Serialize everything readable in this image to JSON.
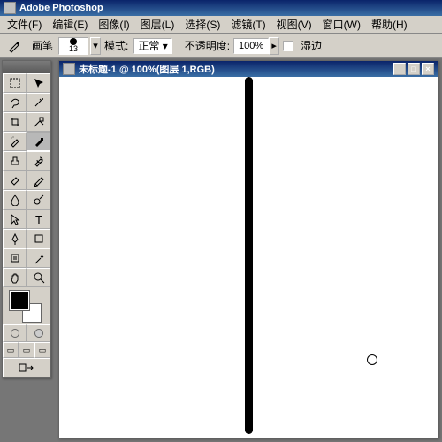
{
  "app": {
    "title": "Adobe Photoshop"
  },
  "menu": [
    "文件(F)",
    "编辑(E)",
    "图像(I)",
    "图层(L)",
    "选择(S)",
    "滤镜(T)",
    "视图(V)",
    "窗口(W)",
    "帮助(H)"
  ],
  "options": {
    "brush_label": "画笔",
    "brush_size": "13",
    "mode_label": "模式:",
    "mode_value": "正常",
    "opacity_label": "不透明度:",
    "opacity_value": "100%",
    "wet_label": "湿边"
  },
  "doc": {
    "title": "未标题-1 @ 100%(图层 1,RGB)"
  },
  "colors": {
    "fg": "#000000",
    "bg": "#ffffff"
  }
}
